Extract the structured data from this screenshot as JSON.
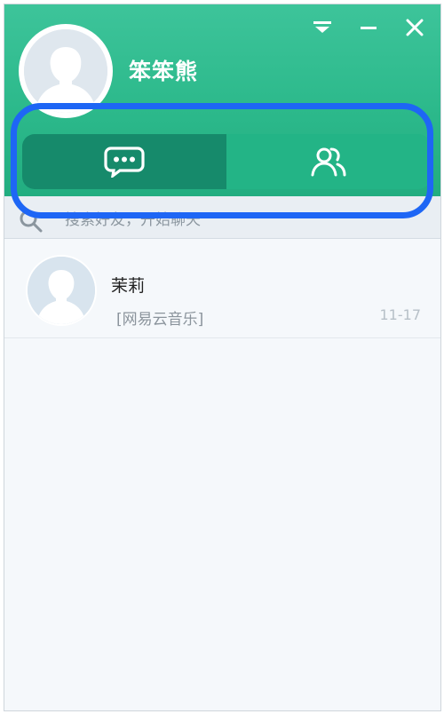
{
  "header": {
    "username": "笨笨熊",
    "bg_color": "#2cb98b"
  },
  "window_controls": [
    "dropdown-icon",
    "minimize-icon",
    "close-icon"
  ],
  "tabs": [
    {
      "name": "tab-chats",
      "icon": "chat-bubble-icon",
      "active": true
    },
    {
      "name": "tab-contacts",
      "icon": "contacts-icon",
      "active": false
    }
  ],
  "search": {
    "placeholder": "搜索好友，开始聊天"
  },
  "chats": [
    {
      "name": "茉莉",
      "preview": "[网易云音乐]",
      "time": "11-17"
    }
  ],
  "colors": {
    "highlight": "#1e66f5",
    "tab_active": "#168a6b"
  }
}
